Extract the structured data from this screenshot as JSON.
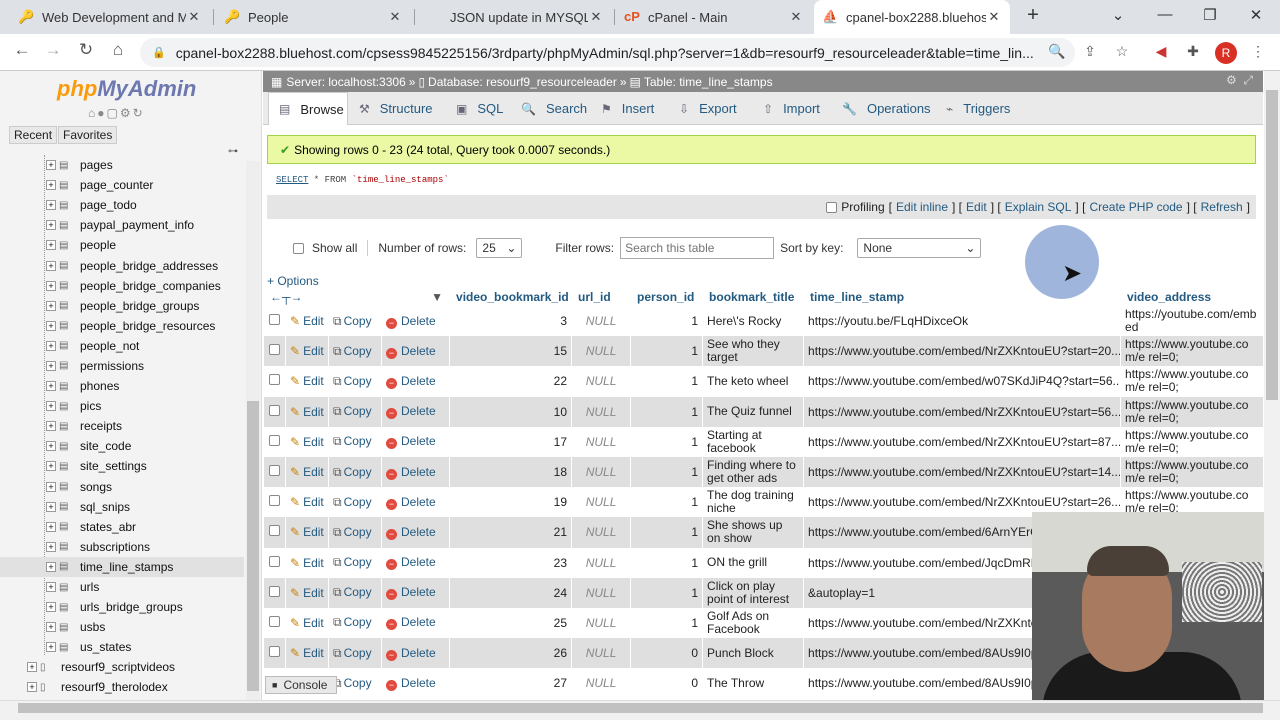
{
  "browser": {
    "tabs": [
      {
        "title": "Web Development and M",
        "icon": "key-icon"
      },
      {
        "title": "People",
        "icon": "key-icon"
      },
      {
        "title": "JSON update in MYSQL d",
        "icon": ""
      },
      {
        "title": "cPanel - Main",
        "icon": "cpanel-icon"
      },
      {
        "title": "cpanel-box2288.bluehost",
        "icon": "phpmyadmin-icon"
      }
    ],
    "url": "cpanel-box2288.bluehost.com/cpsess9845225156/3rdparty/phpMyAdmin/sql.php?server=1&db=resourf9_resourceleader&table=time_lin...",
    "profile_initial": "R"
  },
  "sidebar": {
    "logo_php": "php",
    "logo_rest": "MyAdmin",
    "recent_label": "Recent",
    "favorites_label": "Favorites",
    "tables": [
      "pages",
      "page_counter",
      "page_todo",
      "paypal_payment_info",
      "people",
      "people_bridge_addresses",
      "people_bridge_companies",
      "people_bridge_groups",
      "people_bridge_resources",
      "people_not",
      "permissions",
      "phones",
      "pics",
      "receipts",
      "site_code",
      "site_settings",
      "songs",
      "sql_snips",
      "states_abr",
      "subscriptions",
      "time_line_stamps",
      "urls",
      "urls_bridge_groups",
      "usbs",
      "us_states"
    ],
    "selected_table": "time_line_stamps",
    "databases": [
      "resourf9_scriptvideos",
      "resourf9_therolodex"
    ]
  },
  "breadcrumb": {
    "server": "Server: localhost:3306",
    "database": "Database: resourf9_resourceleader",
    "table": "Table: time_line_stamps"
  },
  "main_tabs": [
    "Browse",
    "Structure",
    "SQL",
    "Search",
    "Insert",
    "Export",
    "Import",
    "Operations",
    "Triggers"
  ],
  "success_message": "Showing rows 0 - 23 (24 total, Query took 0.0007 seconds.)",
  "sql": {
    "keyword": "SELECT",
    "rest": " * FROM ",
    "table": "`time_line_stamps`"
  },
  "profiling": {
    "label": "Profiling",
    "links": [
      "Edit inline",
      "Edit",
      "Explain SQL",
      "Create PHP code",
      "Refresh"
    ]
  },
  "controls": {
    "show_all": "Show all",
    "num_rows_label": "Number of rows:",
    "num_rows_value": "25",
    "filter_label": "Filter rows:",
    "filter_placeholder": "Search this table",
    "sort_label": "Sort by key:",
    "sort_value": "None"
  },
  "options_label": "+ Options",
  "columns": [
    "video_bookmark_id",
    "url_id",
    "person_id",
    "bookmark_title",
    "time_line_stamp",
    "video_address"
  ],
  "actions": {
    "edit": "Edit",
    "copy": "Copy",
    "delete": "Delete"
  },
  "rows": [
    {
      "id": "3",
      "url_id": "NULL",
      "person_id": "1",
      "title": "Here\\'s Rocky",
      "stamp": "https://youtu.be/FLqHDixceOk",
      "address": "https://youtube.com/embed"
    },
    {
      "id": "15",
      "url_id": "NULL",
      "person_id": "1",
      "title": "See who they target",
      "stamp": "https://www.youtube.com/embed/NrZXKntouEU?start=20...",
      "address": "https://www.youtube.com/e rel=0;"
    },
    {
      "id": "22",
      "url_id": "NULL",
      "person_id": "1",
      "title": "The keto wheel",
      "stamp": "https://www.youtube.com/embed/w07SKdJiP4Q?start=56...",
      "address": "https://www.youtube.com/e rel=0;"
    },
    {
      "id": "10",
      "url_id": "NULL",
      "person_id": "1",
      "title": "The Quiz funnel",
      "stamp": "https://www.youtube.com/embed/NrZXKntouEU?start=56...",
      "address": "https://www.youtube.com/e rel=0;"
    },
    {
      "id": "17",
      "url_id": "NULL",
      "person_id": "1",
      "title": "Starting at facebook",
      "stamp": "https://www.youtube.com/embed/NrZXKntouEU?start=87...",
      "address": "https://www.youtube.com/e rel=0;"
    },
    {
      "id": "18",
      "url_id": "NULL",
      "person_id": "1",
      "title": "Finding where to get other ads",
      "stamp": "https://www.youtube.com/embed/NrZXKntouEU?start=14...",
      "address": "https://www.youtube.com/e rel=0;"
    },
    {
      "id": "19",
      "url_id": "NULL",
      "person_id": "1",
      "title": "The dog training niche",
      "stamp": "https://www.youtube.com/embed/NrZXKntouEU?start=26...",
      "address": "https://www.youtube.com/e rel=0;"
    },
    {
      "id": "21",
      "url_id": "NULL",
      "person_id": "1",
      "title": "She shows up on show",
      "stamp": "https://www.youtube.com/embed/6ArnYErC",
      "address": ""
    },
    {
      "id": "23",
      "url_id": "NULL",
      "person_id": "1",
      "title": "ON the grill",
      "stamp": "https://www.youtube.com/embed/JqcDmRF",
      "address": ""
    },
    {
      "id": "24",
      "url_id": "NULL",
      "person_id": "1",
      "title": "Click on play point of interest",
      "stamp": "&autoplay=1",
      "address": ""
    },
    {
      "id": "25",
      "url_id": "NULL",
      "person_id": "1",
      "title": "Golf Ads on Facebook",
      "stamp": "https://www.youtube.com/embed/NrZXKnto",
      "address": ""
    },
    {
      "id": "26",
      "url_id": "NULL",
      "person_id": "0",
      "title": "Punch Block",
      "stamp": "https://www.youtube.com/embed/8AUs9I0p",
      "address": ""
    },
    {
      "id": "27",
      "url_id": "NULL",
      "person_id": "0",
      "title": "The Throw",
      "stamp": "https://www.youtube.com/embed/8AUs9I0p",
      "address": ""
    }
  ],
  "console_label": "Console"
}
